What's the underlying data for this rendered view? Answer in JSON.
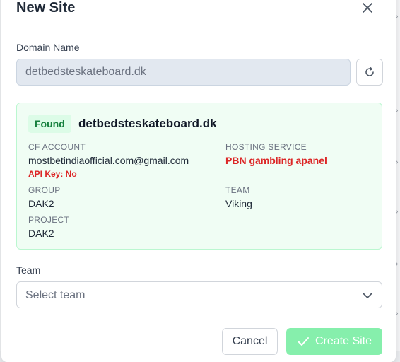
{
  "modal": {
    "title": "New Site",
    "domain_label": "Domain Name",
    "domain_value": "detbedsteskateboard.dk",
    "team_label": "Team",
    "team_placeholder": "Select team",
    "cancel_label": "Cancel",
    "create_label": "Create Site"
  },
  "found": {
    "badge": "Found",
    "domain": "detbedsteskateboard.dk",
    "cf_account_label": "CF ACCOUNT",
    "cf_account_value": "mostbetindiaofficial.com@gmail.com",
    "api_key_text": "API Key: No",
    "hosting_label": "HOSTING SERVICE",
    "hosting_value": "PBN gambling apanel",
    "group_label": "GROUP",
    "group_value": "DAK2",
    "team_label": "TEAM",
    "team_value": "Viking",
    "project_label": "PROJECT",
    "project_value": "DAK2"
  },
  "icons": {
    "close": "close-icon",
    "refresh": "refresh-icon",
    "chevron": "chevron-down-icon",
    "check": "check-icon"
  },
  "colors": {
    "found_bg": "#f0fdf4",
    "found_badge": "#15803d",
    "error_red": "#dc2626",
    "primary_disabled": "#86efac"
  }
}
